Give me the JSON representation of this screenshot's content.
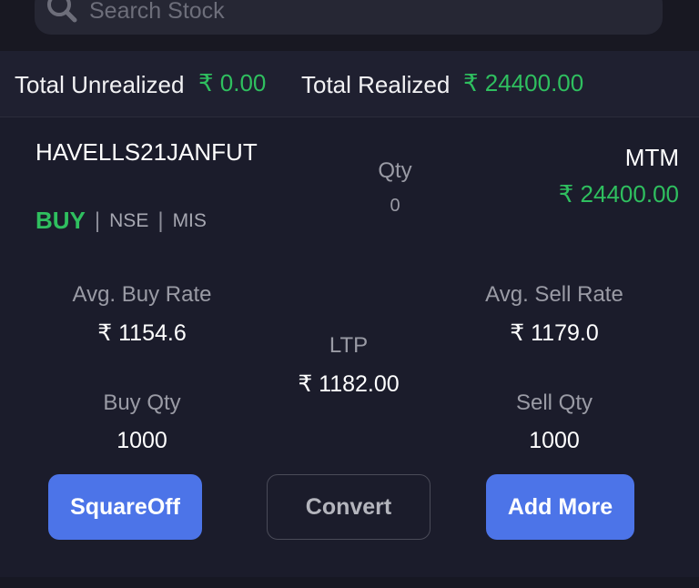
{
  "search": {
    "placeholder": "Search Stock"
  },
  "totals": {
    "unrealized_label": "Total Unrealized",
    "unrealized_value": "₹ 0.00",
    "realized_label": "Total Realized",
    "realized_value": "₹ 24400.00"
  },
  "position": {
    "symbol": "HAVELLS21JANFUT",
    "side": "BUY",
    "exchange": "NSE",
    "product": "MIS",
    "separator": "|",
    "qty_label": "Qty",
    "qty_value": "0",
    "mtm_label": "MTM",
    "mtm_value": "₹ 24400.00",
    "avg_buy_label": "Avg. Buy Rate",
    "avg_buy_value": "₹ 1154.6",
    "avg_sell_label": "Avg. Sell Rate",
    "avg_sell_value": "₹ 1179.0",
    "ltp_label": "LTP",
    "ltp_value": "₹ 1182.00",
    "buy_qty_label": "Buy Qty",
    "buy_qty_value": "1000",
    "sell_qty_label": "Sell Qty",
    "sell_qty_value": "1000"
  },
  "actions": {
    "squareoff_label": "SquareOff",
    "convert_label": "Convert",
    "add_more_label": "Add More"
  },
  "colors": {
    "background": "#1a1b26",
    "profit_green": "#2fbf5f",
    "button_blue": "#4c74e8"
  },
  "icons": {
    "search": "search-icon"
  }
}
